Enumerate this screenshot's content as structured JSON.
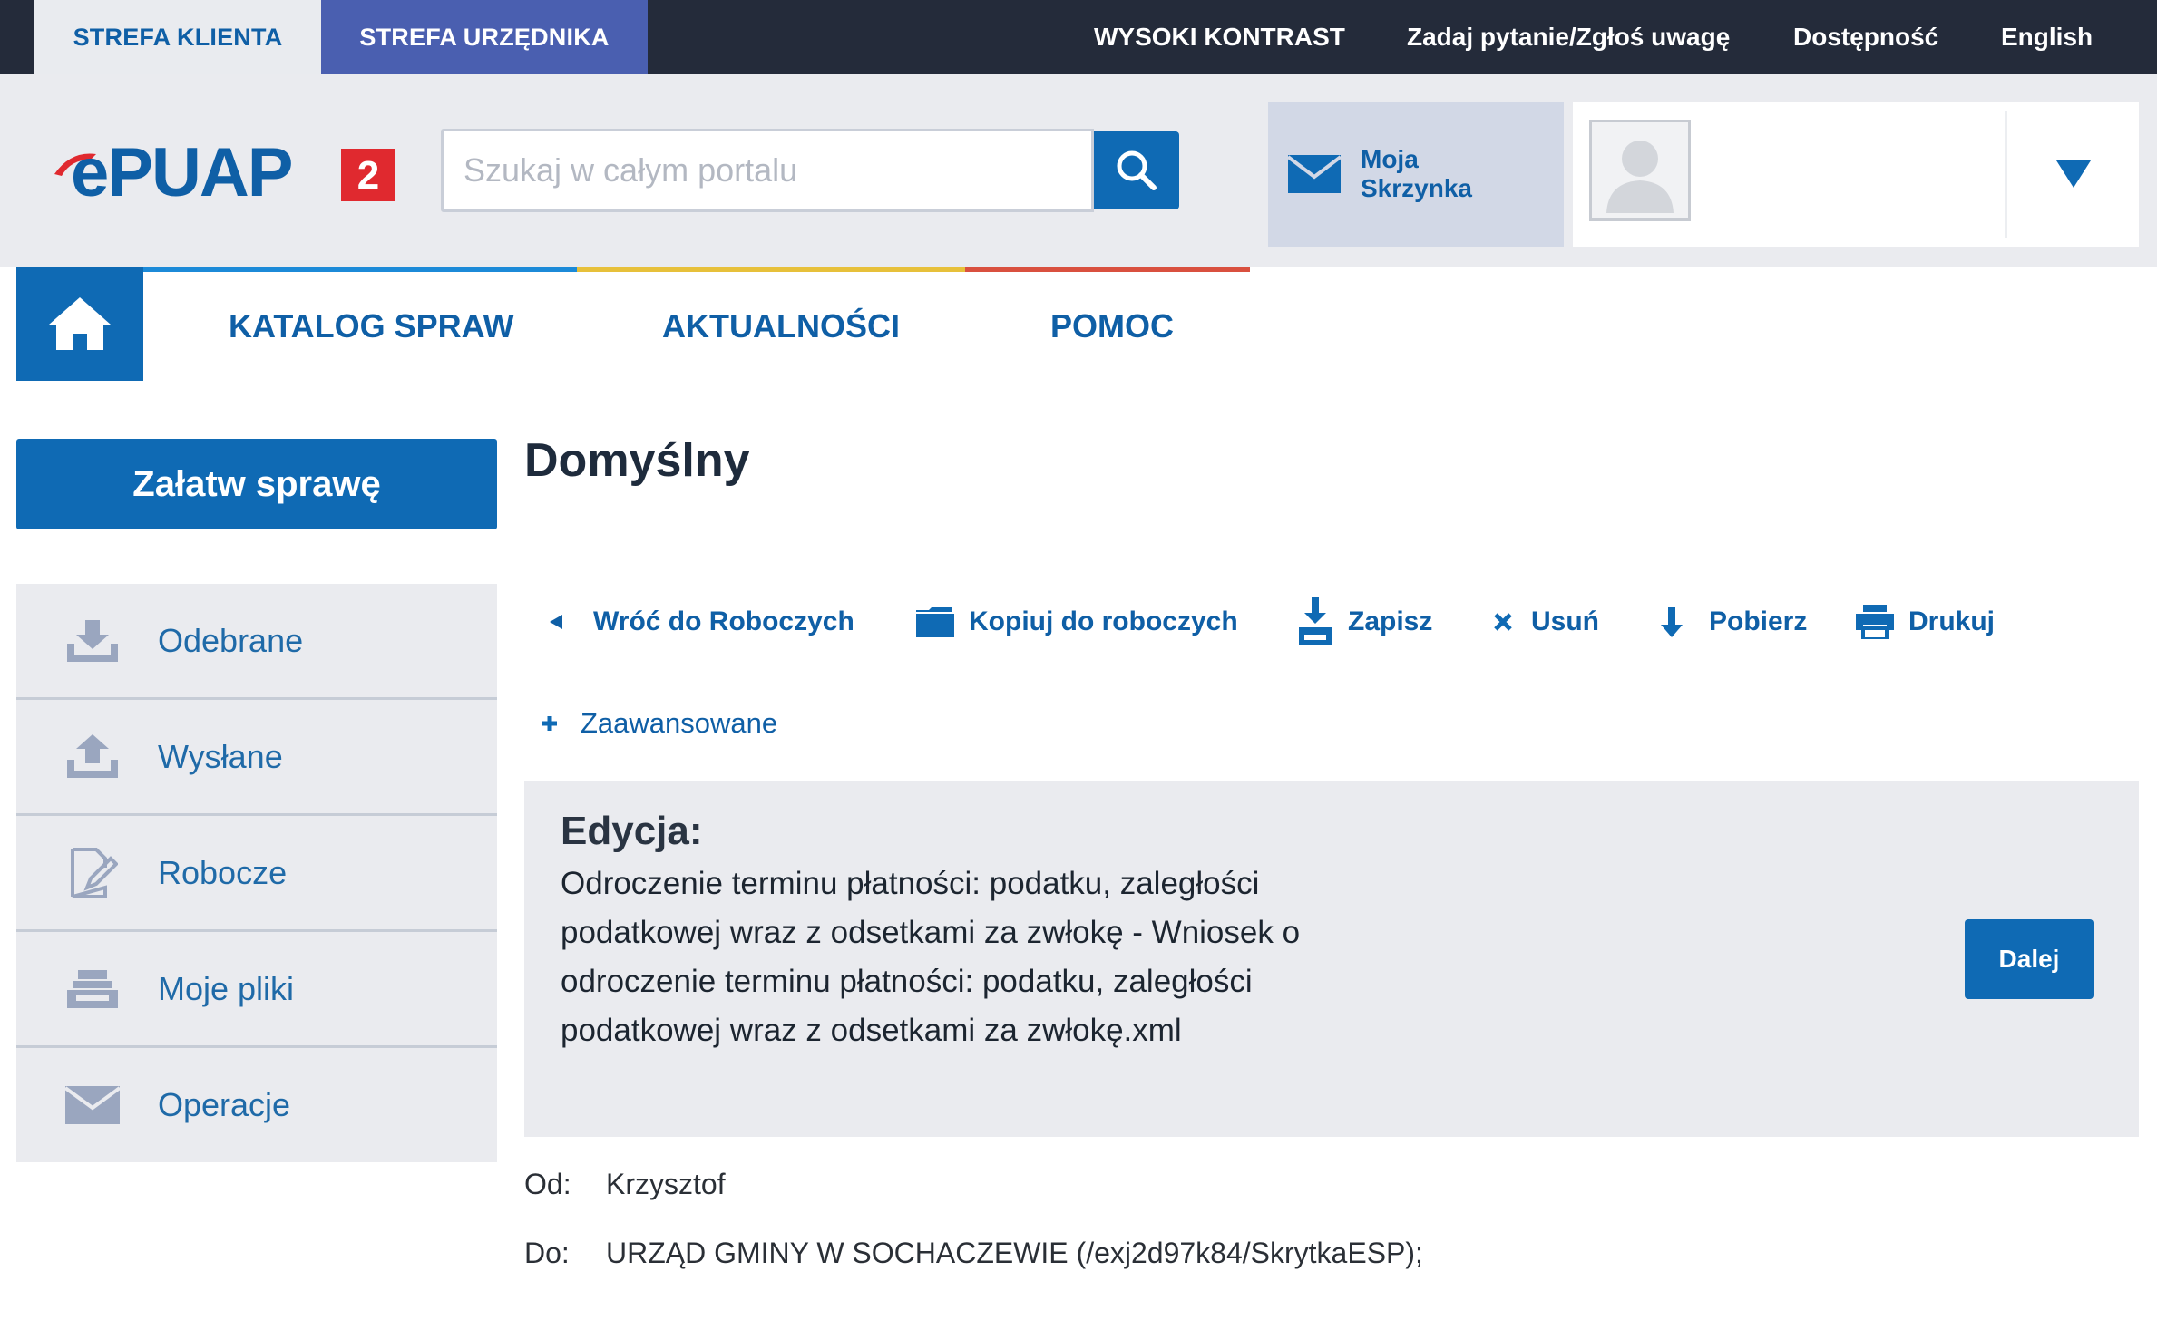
{
  "topbar": {
    "zone_client": "STREFA KLIENTA",
    "zone_clerk": "STREFA URZĘDNIKA",
    "high_contrast": "WYSOKI KONTRAST",
    "ask_question": "Zadaj pytanie/Zgłoś uwagę",
    "accessibility": "Dostępność",
    "language": "English"
  },
  "header": {
    "logo_text": "ePUAP",
    "logo_badge": "2",
    "search_placeholder": "Szukaj w całym portalu",
    "mailbox_label_1": "Moja",
    "mailbox_label_2": "Skrzynka"
  },
  "colors": {
    "brand_blue": "#0f6ab4",
    "topbar_dark": "#242b3a",
    "clerk_tab": "#4a5fb0",
    "nav_line_blue": "#1c8ad8",
    "nav_line_yellow": "#e7c03a",
    "nav_line_red": "#d9503f",
    "logo_red": "#e0292f"
  },
  "nav": {
    "items": [
      {
        "label": "KATALOG SPRAW"
      },
      {
        "label": "AKTUALNOŚCI"
      },
      {
        "label": "POMOC"
      }
    ]
  },
  "sidebar": {
    "cta": "Załatw sprawę",
    "items": [
      {
        "label": "Odebrane",
        "icon": "inbox-download-icon"
      },
      {
        "label": "Wysłane",
        "icon": "outbox-upload-icon"
      },
      {
        "label": "Robocze",
        "icon": "draft-edit-icon"
      },
      {
        "label": "Moje pliki",
        "icon": "files-tray-icon"
      },
      {
        "label": "Operacje",
        "icon": "envelope-icon"
      }
    ]
  },
  "main": {
    "title": "Domyślny",
    "actions": [
      {
        "label": "Wróć do Roboczych",
        "icon": "back-arrow-icon"
      },
      {
        "label": "Kopiuj do roboczych",
        "icon": "folder-icon"
      },
      {
        "label": "Zapisz",
        "icon": "save-icon"
      },
      {
        "label": "Usuń",
        "icon": "delete-x-icon"
      },
      {
        "label": "Pobierz",
        "icon": "download-arrow-icon"
      },
      {
        "label": "Drukuj",
        "icon": "print-icon"
      }
    ],
    "advanced": "Zaawansowane",
    "edit_label": "Edycja:",
    "edit_document": "Odroczenie terminu płatności: podatku, zaległości podatkowej wraz z odsetkami za zwłokę - Wniosek o odroczenie terminu płatności: podatku, zaległości podatkowej wraz z odsetkami za zwłokę.xml",
    "next_button": "Dalej",
    "from_label": "Od:",
    "from_value": "Krzysztof",
    "to_label": "Do:",
    "to_value": "URZĄD GMINY W SOCHACZEWIE (/exj2d97k84/SkrytkaESP);"
  }
}
